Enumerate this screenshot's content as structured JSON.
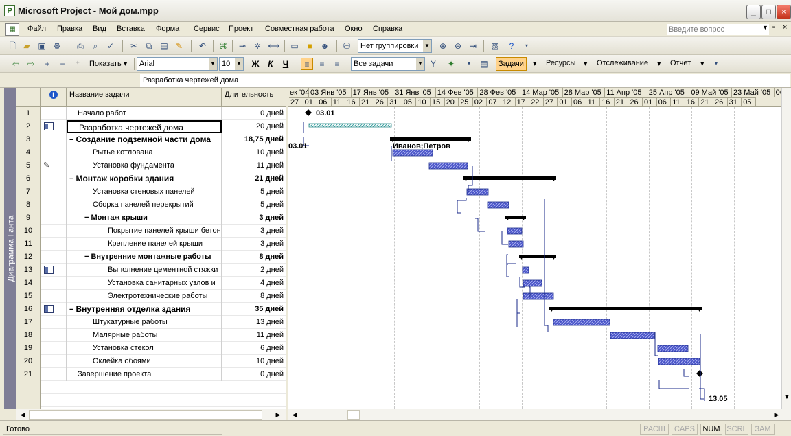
{
  "window": {
    "title": "Microsoft Project - Мой дом.mpp"
  },
  "menu": {
    "items": [
      "Файл",
      "Правка",
      "Вид",
      "Вставка",
      "Формат",
      "Сервис",
      "Проект",
      "Совместная работа",
      "Окно",
      "Справка"
    ],
    "ask_placeholder": "Введите вопрос"
  },
  "toolbar1": {
    "grouping": "Нет группировки"
  },
  "toolbar2": {
    "show_label": "Показать",
    "font": "Arial",
    "size": "10",
    "bold": "Ж",
    "italic": "К",
    "underline": "Ч",
    "filter": "Все задачи",
    "tasks_btn": "Задачи",
    "resources_btn": "Ресурсы",
    "tracking_btn": "Отслеживание",
    "report_btn": "Отчет"
  },
  "entry_bar": {
    "value": "Разработка чертежей дома"
  },
  "view_bar": {
    "label": "Диаграмма Ганта"
  },
  "grid": {
    "headers": {
      "name": "Название задачи",
      "duration": "Длительность"
    },
    "rows": [
      {
        "id": "1",
        "name": "Начало работ",
        "duration": "0 дней",
        "indent": 0,
        "summary": false,
        "indicator": ""
      },
      {
        "id": "2",
        "name": "Разработка чертежей дома",
        "duration": "20 дней",
        "indent": 0,
        "summary": false,
        "indicator": "gantt",
        "selected": true
      },
      {
        "id": "3",
        "name": "Создание подземной части дома",
        "duration": "18,75 дней",
        "indent": 0,
        "summary": true,
        "indicator": ""
      },
      {
        "id": "4",
        "name": "Рытье котлована",
        "duration": "10 дней",
        "indent": 1,
        "summary": false,
        "indicator": ""
      },
      {
        "id": "5",
        "name": "Установка фундамента",
        "duration": "11 дней",
        "indent": 1,
        "summary": false,
        "indicator": "note"
      },
      {
        "id": "6",
        "name": "Монтаж коробки здания",
        "duration": "21 дней",
        "indent": 0,
        "summary": true,
        "indicator": ""
      },
      {
        "id": "7",
        "name": "Установка стеновых панелей",
        "duration": "5 дней",
        "indent": 1,
        "summary": false,
        "indicator": ""
      },
      {
        "id": "8",
        "name": "Сборка панелей перекрытий",
        "duration": "5 дней",
        "indent": 1,
        "summary": false,
        "indicator": ""
      },
      {
        "id": "9",
        "name": "Монтаж крыши",
        "duration": "3 дней",
        "indent": 1,
        "summary": true,
        "indicator": ""
      },
      {
        "id": "10",
        "name": "Покрытие панелей крыши бетоном",
        "duration": "3 дней",
        "indent": 2,
        "summary": false,
        "indicator": ""
      },
      {
        "id": "11",
        "name": "Крепление панелей крыши",
        "duration": "3 дней",
        "indent": 2,
        "summary": false,
        "indicator": ""
      },
      {
        "id": "12",
        "name": "Внутренние монтажные работы",
        "duration": "8 дней",
        "indent": 1,
        "summary": true,
        "indicator": ""
      },
      {
        "id": "13",
        "name": "Выполнение цементной стяжки",
        "duration": "2 дней",
        "indent": 2,
        "summary": false,
        "indicator": "gantt"
      },
      {
        "id": "14",
        "name": "Установка санитарных узлов и",
        "duration": "4 дней",
        "indent": 2,
        "summary": false,
        "indicator": ""
      },
      {
        "id": "15",
        "name": "Электротехнические работы",
        "duration": "8 дней",
        "indent": 2,
        "summary": false,
        "indicator": ""
      },
      {
        "id": "16",
        "name": "Внутренняя отделка здания",
        "duration": "35 дней",
        "indent": 0,
        "summary": true,
        "indicator": "gantt"
      },
      {
        "id": "17",
        "name": "Штукатурные работы",
        "duration": "13 дней",
        "indent": 1,
        "summary": false,
        "indicator": ""
      },
      {
        "id": "18",
        "name": "Малярные работы",
        "duration": "11 дней",
        "indent": 1,
        "summary": false,
        "indicator": ""
      },
      {
        "id": "19",
        "name": "Установка стекол",
        "duration": "6 дней",
        "indent": 1,
        "summary": false,
        "indicator": ""
      },
      {
        "id": "20",
        "name": "Оклейка обоями",
        "duration": "10 дней",
        "indent": 1,
        "summary": false,
        "indicator": ""
      },
      {
        "id": "21",
        "name": "Завершение проекта",
        "duration": "0 дней",
        "indent": 0,
        "summary": false,
        "indicator": ""
      }
    ]
  },
  "gantt": {
    "major": [
      "ек '04",
      "03 Янв '05",
      "17 Янв '05",
      "31 Янв '05",
      "14 Фев '05",
      "28 Фев '05",
      "14 Мар '05",
      "28 Мар '05",
      "11 Апр '05",
      "25 Апр '05",
      "09 Май '05",
      "23 Май '05",
      "06"
    ],
    "minor": [
      "27",
      "01",
      "06",
      "11",
      "16",
      "21",
      "26",
      "31",
      "05",
      "10",
      "15",
      "20",
      "25",
      "02",
      "07",
      "12",
      "17",
      "22",
      "27",
      "01",
      "06",
      "11",
      "16",
      "21",
      "26",
      "01",
      "06",
      "11",
      "16",
      "21",
      "26",
      "31",
      "05"
    ],
    "labels": {
      "m1": "03.01",
      "res2": "Иванов;Петров",
      "start2": "03.01",
      "m21": "13.05"
    }
  },
  "status": {
    "ready": "Готово",
    "indicators": [
      {
        "text": "РАСШ",
        "on": false
      },
      {
        "text": "CAPS",
        "on": false
      },
      {
        "text": "NUM",
        "on": true
      },
      {
        "text": "SCRL",
        "on": false
      },
      {
        "text": "ЗАМ",
        "on": false
      }
    ]
  }
}
